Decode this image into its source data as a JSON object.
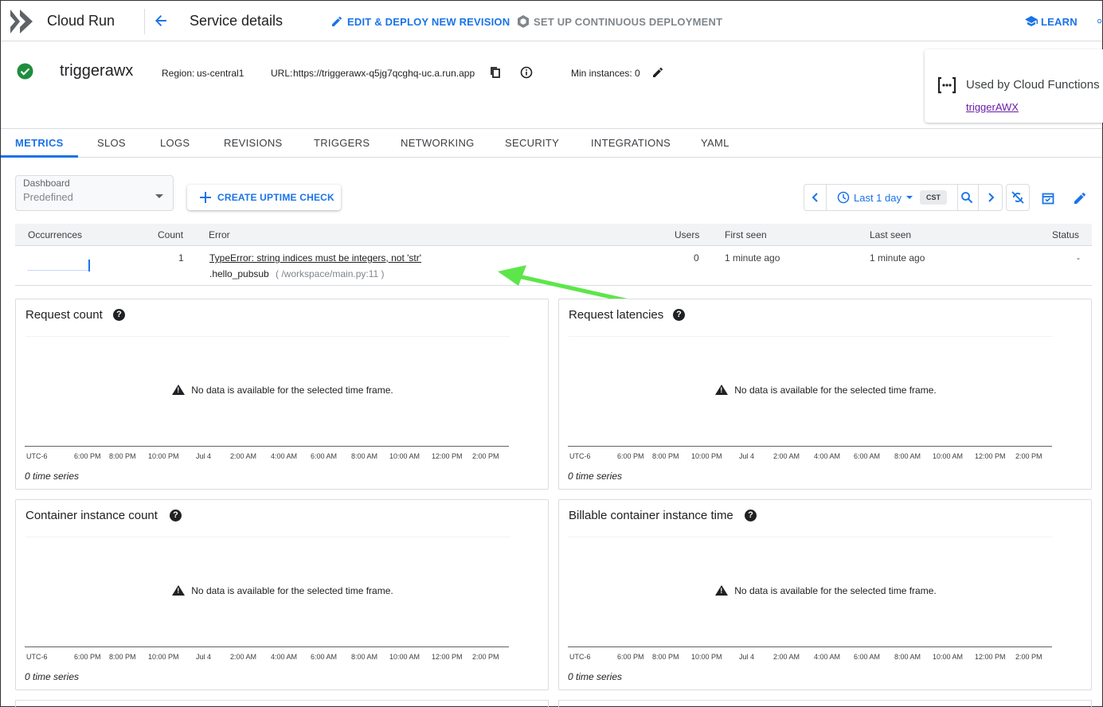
{
  "topbar": {
    "product": "Cloud Run",
    "page_title": "Service details",
    "edit_deploy": "EDIT & DEPLOY NEW REVISION",
    "continuous": "SET UP CONTINUOUS DEPLOYMENT",
    "learn": "LEARN"
  },
  "service": {
    "name": "triggerawx",
    "region_label": "Region:",
    "region": "us-central1",
    "url_label": "URL:",
    "url": "https://triggerawx-q5jg7qcghq-uc.a.run.app",
    "min_instances": "Min instances: 0",
    "status_color": "#1e8e3e"
  },
  "used_by": {
    "label": "Used by Cloud Functions",
    "link": "triggerAWX"
  },
  "tabs": [
    "METRICS",
    "SLOS",
    "LOGS",
    "REVISIONS",
    "TRIGGERS",
    "NETWORKING",
    "SECURITY",
    "INTEGRATIONS",
    "YAML"
  ],
  "dashboard": {
    "label": "Dashboard",
    "value": "Predefined",
    "create_uptime": "CREATE UPTIME CHECK"
  },
  "time": {
    "range": "Last 1 day",
    "tz": "CST"
  },
  "errors": {
    "headers": {
      "occurrences": "Occurrences",
      "count": "Count",
      "error": "Error",
      "users": "Users",
      "first_seen": "First seen",
      "last_seen": "Last seen",
      "status": "Status"
    },
    "rows": [
      {
        "count": "1",
        "error": "TypeError: string indices must be integers, not 'str'",
        "location_func": ".hello_pubsub",
        "location_file": "( /workspace/main.py:11 )",
        "users": "0",
        "first_seen": "1 minute ago",
        "last_seen": "1 minute ago",
        "status": "-"
      }
    ]
  },
  "charts": {
    "nodata": "No data is available for the selected time frame.",
    "time_series": "0 time series",
    "ticks": [
      "UTC-6",
      "6:00 PM",
      "8:00 PM",
      "10:00 PM",
      "Jul 4",
      "2:00 AM",
      "4:00 AM",
      "6:00 AM",
      "8:00 AM",
      "10:00 AM",
      "12:00 PM",
      "2:00 PM"
    ],
    "cards": [
      {
        "title": "Request count"
      },
      {
        "title": "Request latencies"
      },
      {
        "title": "Container instance count"
      },
      {
        "title": "Billable container instance time"
      }
    ]
  },
  "colors": {
    "accent": "#1a73e8",
    "arrow": "#5de64a",
    "link_purple": "#681da8"
  }
}
